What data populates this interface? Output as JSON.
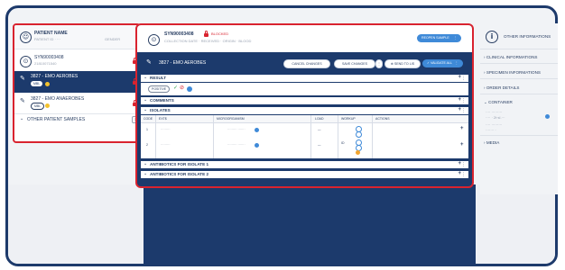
{
  "left": {
    "patient_label": "PATIENT NAME",
    "patient_sub": "PATIENT ID  ·  ···",
    "patient_sub2": "GENDER",
    "sample_id": "SYN90003408",
    "sample_sub": "21810071540",
    "items": [
      {
        "label": "3827 - EMO AEROBES",
        "selected": true,
        "badges": [
          "MBL"
        ],
        "dot_color": "#f2c12e"
      },
      {
        "label": "3827 - EMO ANAEROBES",
        "selected": false,
        "badges": [
          "MBL"
        ],
        "dot_color": "#f2c12e"
      }
    ],
    "other_samples_label": "OTHER PATIENT SAMPLES",
    "other_samples_count": "1"
  },
  "center": {
    "sample_id": "SYN90003408",
    "status": "BLOCKED",
    "sub_line": "COLLECTION DATE  ·  RECEIVED  ·  ORIGIN  ·  BLOOD",
    "top_button": "REOPEN SAMPLE",
    "test_name": "3827 - EMO AEROBES",
    "buttons": {
      "cancel": "CANCEL CHANGES",
      "save": "SAVE CHANGES",
      "send": "SEND TO LIS",
      "validate": "VALIDATE ALL"
    },
    "sections": {
      "result": "RESULT",
      "comments": "COMMENTS",
      "isolates": "ISOLATES",
      "antibiotics1": "ANTIBIOTICS FOR ISOLATE 1",
      "antibiotics2": "ANTIBIOTICS FOR ISOLATE 2"
    },
    "result_chip": "POSITIVE",
    "isolates_table": {
      "headers": [
        "CODE",
        "EXT$",
        "MICROORGANISM",
        "LOAD",
        "WORKUP",
        "ACTIONS"
      ],
      "rows": [
        {
          "code": "1",
          "ext": "·········",
          "micro": "·········  ·······",
          "load": "—",
          "workup": ""
        },
        {
          "code": "2",
          "ext": "·········",
          "micro": "·········  ·······",
          "load": "—",
          "workup": "ID"
        }
      ]
    }
  },
  "right": {
    "header": "OTHER INFORMATIONS",
    "items": [
      "CLINICAL INFORMATIONS",
      "SPECIMEN INFORMATIONS",
      "ORDER DETAILS",
      "CONTAINER",
      "MEDIA"
    ],
    "container_lines": [
      "····  ·········",
      "····  · 2t·sl.···",
      "····  ·········",
      "·······  ·"
    ]
  },
  "colors": {
    "navy": "#1c3a6c",
    "highlight_red": "#d9232f",
    "accent_blue": "#3f8ad8",
    "warning_yellow": "#f2c12e"
  }
}
